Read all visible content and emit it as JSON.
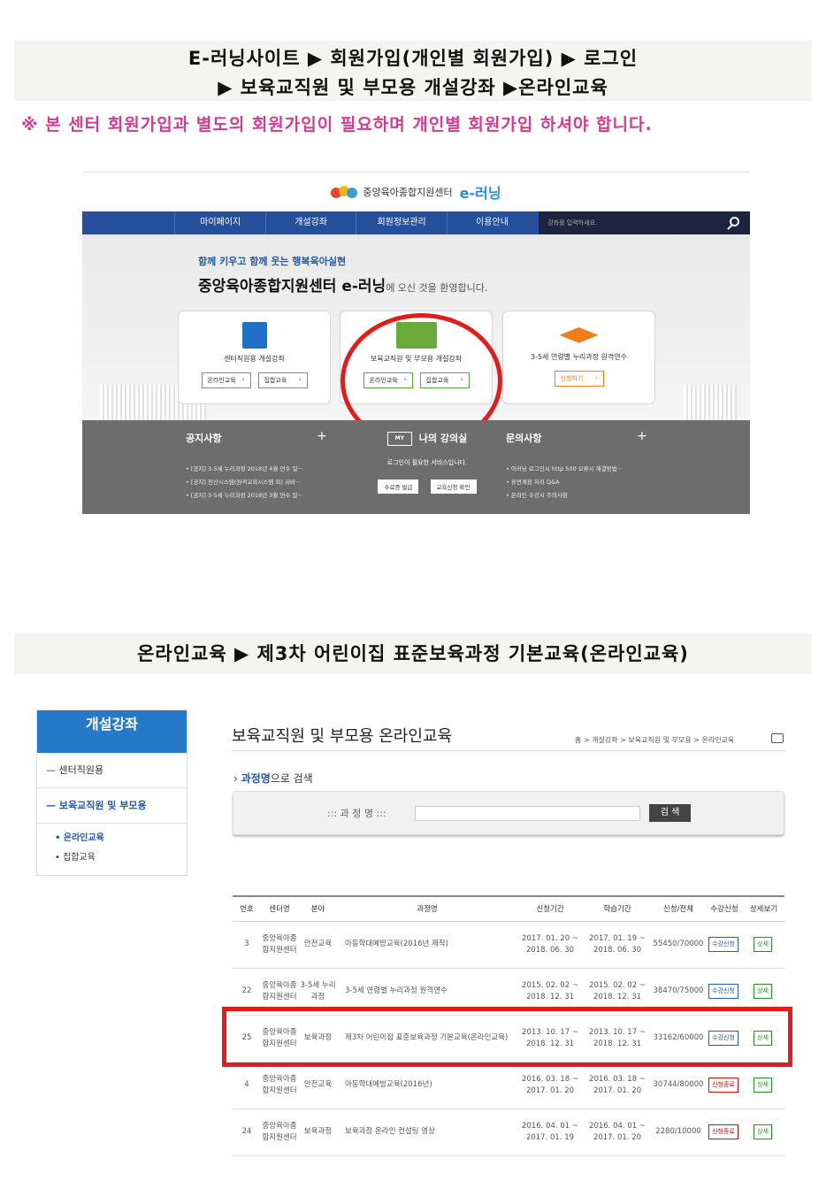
{
  "banner1": {
    "line1": "E-러닝사이트 ▶ 회원가입(개인별 회원가입) ▶ 로그인",
    "line2": "▶ 보육교직원 및 부모용 개설강좌 ▶온라인교육"
  },
  "note": "※ 본 센터 회원가입과 별도의 회원가입이 필요하며 개인별 회원가입 하셔야 합니다.",
  "shot1": {
    "logo_text": "중앙육아종합지원센터",
    "logo_brand": "e-러닝",
    "nav": [
      "마이페이지",
      "개설강좌",
      "회원정보관리",
      "이용안내"
    ],
    "search_placeholder": "강좌를 입력하세요.",
    "tagline": "함께 키우고 함께 웃는 행복육아실현",
    "welcome_main": "중앙육아종합지원센터 e-러닝",
    "welcome_tail": "에 오신 것을 환영합니다.",
    "cards": [
      {
        "title": "센터직원용 개설강좌",
        "btn1": "온라인교육",
        "btn2": "집합교육",
        "color": "#1f6fc8"
      },
      {
        "title": "보육교직원 및 부모용 개설강좌",
        "btn1": "온라인교육",
        "btn2": "집합교육",
        "color": "#6aaa3a"
      },
      {
        "title": "3-5세 연령별 누리과정 원격연수",
        "btn1": "신청하기",
        "color": "#ef7d1a"
      }
    ],
    "notice": {
      "heading": "공지사항",
      "items": [
        "[공지] 3-5세 누리과정 2018년 4월 연수 일···",
        "[공지] 전산시스템(원격교육시스템 외) 서비···",
        "[공지] 3-5세 누리과정 2018년 3월 연수 일···"
      ]
    },
    "my": {
      "badge": "MY",
      "heading": "나의 강의실",
      "desc": "로그인이 필요한 서비스입니다.",
      "btn1": "수료증 발급",
      "btn2": "교육신청 확인"
    },
    "inquiry": {
      "heading": "문의사항",
      "items": [
        "이러닝 로그인시 http 500 오류시 해결방법···",
        "휴면계정 처리 Q&A",
        "온라인 수강시 주의사항"
      ]
    }
  },
  "banner2": "온라인교육 ▶ 제3차 어린이집 표준보육과정 기본교육(온라인교육)",
  "shot2": {
    "side": {
      "heading": "개설강좌",
      "items": [
        "센터직원용",
        "보육교직원 및 부모용"
      ],
      "subs": [
        "온라인교육",
        "집합교육"
      ]
    },
    "page_title": "보육교직원 및 부모용 온라인교육",
    "breadcrumb": "홈 > 개설강좌 > 보육교직원 및 부모용 > 온라인교육",
    "search_label_bold": "과정명",
    "search_label_rest": "으로 검색",
    "search_field_label": "::: 과 정 명 :::",
    "search_button": "검 색",
    "table": {
      "headers": [
        "번호",
        "센터명",
        "분야",
        "과정명",
        "신청기간",
        "학습기간",
        "신청/전체",
        "수강신청",
        "상세보기"
      ],
      "rows": [
        {
          "no": "3",
          "center": "중앙육아종합지원센터",
          "field": "안전교육",
          "course": "아동학대예방교육(2016년 제작)",
          "apply": "2017. 01. 20 ~ 2018. 06. 30",
          "study": "2017. 01. 19 ~ 2018. 06. 30",
          "count": "55450/70000",
          "status": "수강신청",
          "detail": "상세"
        },
        {
          "no": "22",
          "center": "중앙육아종합지원센터",
          "field": "3-5세 누리과정",
          "course": "3-5세 연령별 누리과정 원격연수",
          "apply": "2015. 02. 02 ~ 2018. 12. 31",
          "study": "2015. 02. 02 ~ 2018. 12. 31",
          "count": "38470/75000",
          "status": "수강신청",
          "detail": "상세"
        },
        {
          "no": "25",
          "center": "중앙육아종합지원센터",
          "field": "보육과정",
          "course": "제3차 어린이집 표준보육과정 기본교육(온라인교육)",
          "apply": "2013. 10. 17 ~ 2018. 12. 31",
          "study": "2013. 10. 17 ~ 2018. 12. 31",
          "count": "33162/60000",
          "status": "수강신청",
          "detail": "상세"
        },
        {
          "no": "4",
          "center": "중앙육아종합지원센터",
          "field": "안전교육",
          "course": "아동학대예방교육(2016년)",
          "apply": "2016. 03. 18 ~ 2017. 01. 20",
          "study": "2016. 03. 18 ~ 2017. 01. 20",
          "count": "30744/80000",
          "status": "신청종료",
          "detail": "상세"
        },
        {
          "no": "24",
          "center": "중앙육아종합지원센터",
          "field": "보육과정",
          "course": "보육과정 온라인 컨설팅 영상",
          "apply": "2016. 04. 01 ~ 2017. 01. 19",
          "study": "2016. 04. 01 ~ 2017. 01. 20",
          "count": "2280/10000",
          "status": "신청종료",
          "detail": "상세"
        }
      ]
    }
  }
}
